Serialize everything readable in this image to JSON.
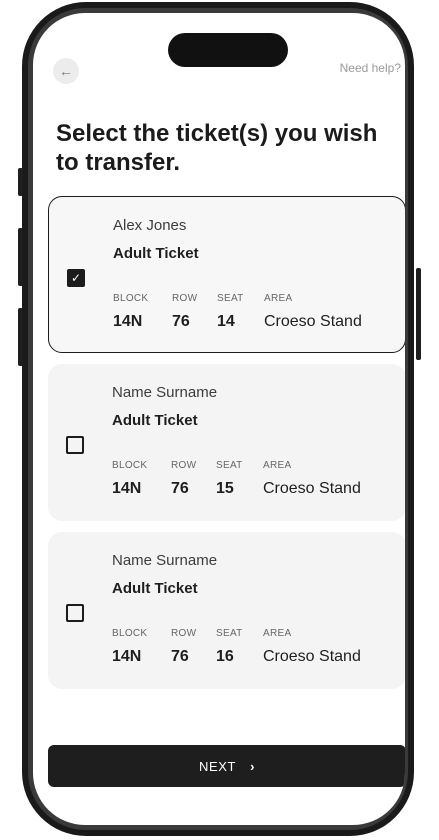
{
  "header": {
    "back_icon": "arrow-left-icon",
    "help_label": "Need help?"
  },
  "title": "Select the ticket(s) you wish to transfer.",
  "seat_labels": {
    "block": "BLOCK",
    "row": "ROW",
    "seat": "SEAT",
    "area": "AREA"
  },
  "tickets": [
    {
      "name": "Alex Jones",
      "type": "Adult Ticket",
      "block": "14N",
      "row": "76",
      "seat": "14",
      "area": "Croeso Stand",
      "selected": true
    },
    {
      "name": "Name Surname",
      "type": "Adult Ticket",
      "block": "14N",
      "row": "76",
      "seat": "15",
      "area": "Croeso Stand",
      "selected": false
    },
    {
      "name": "Name Surname",
      "type": "Adult Ticket",
      "block": "14N",
      "row": "76",
      "seat": "16",
      "area": "Croeso Stand",
      "selected": false
    }
  ],
  "next_button": {
    "label": "NEXT",
    "icon": "chevron-right-icon"
  },
  "colors": {
    "accent": "#1c1c1c",
    "card_bg": "#f4f4f4",
    "text_secondary": "#9a9a9a"
  }
}
